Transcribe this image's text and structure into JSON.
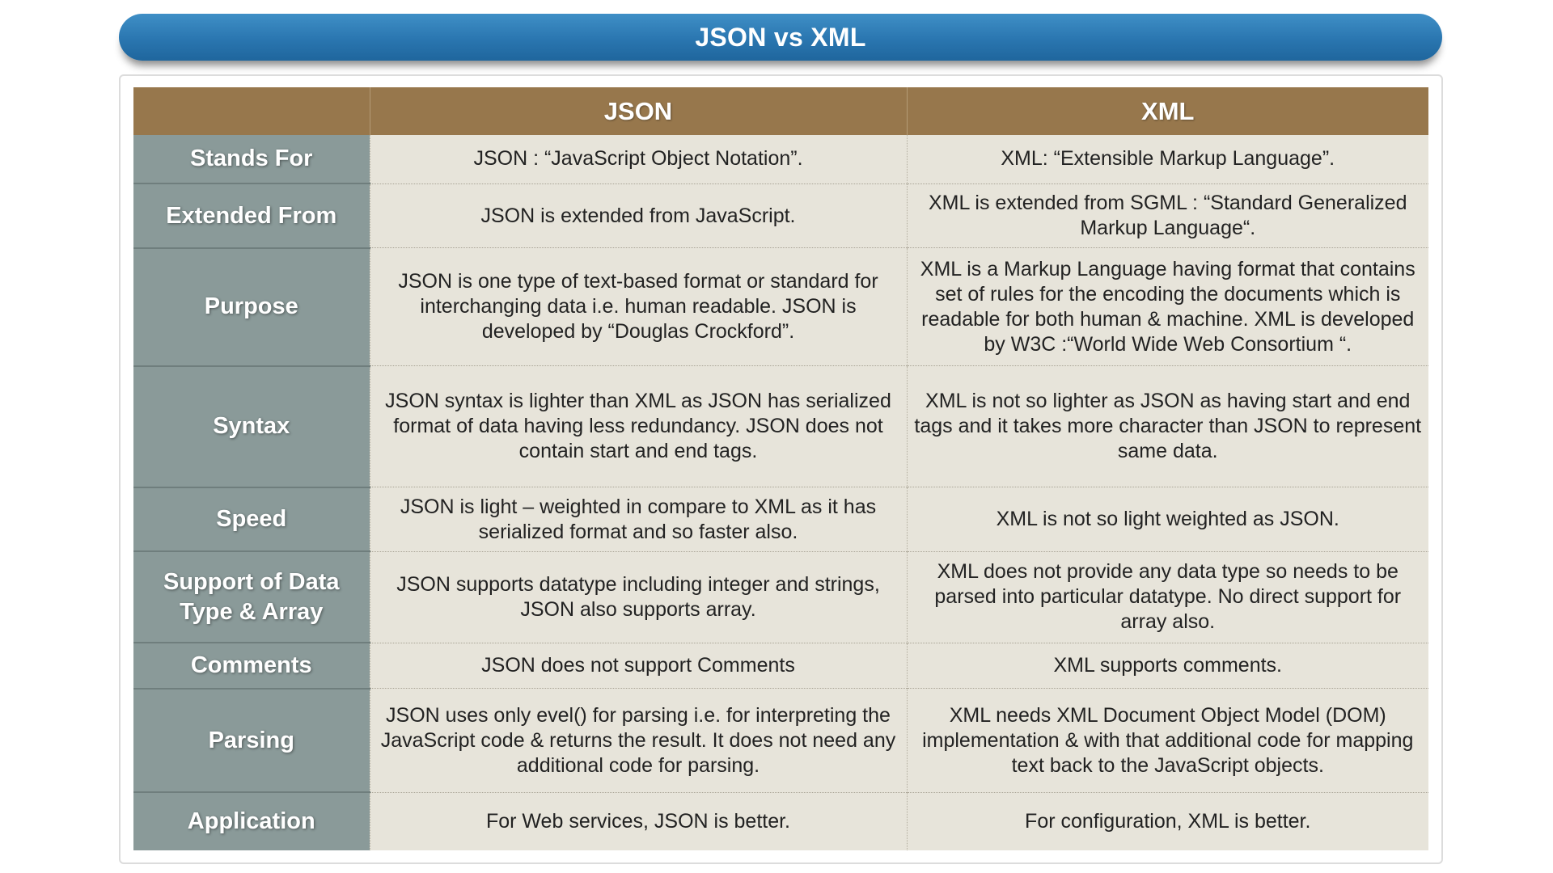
{
  "title": "JSON vs XML",
  "table": {
    "columns": [
      "",
      "JSON",
      "XML"
    ],
    "rows": [
      {
        "label": "Stands For",
        "json": "JSON : “JavaScript Object Notation”.",
        "xml": "XML: “Extensible Markup Language”."
      },
      {
        "label": "Extended From",
        "json": "JSON is extended from JavaScript.",
        "xml": "XML is extended from SGML : “Standard Generalized Markup Language“."
      },
      {
        "label": "Purpose",
        "json": "JSON is one type of text-based format or standard for interchanging  data i.e. human readable.  JSON is developed by “Douglas Crockford”.",
        "xml": "XML is a Markup Language having format that contains set of rules for the encoding the documents which is readable for both human & machine. XML is developed by W3C :“World Wide Web Consortium “."
      },
      {
        "label": "Syntax",
        "json": "JSON syntax is lighter than XML as JSON has serialized format of data having  less redundancy. JSON does not contain start and end tags.",
        "xml": "XML is not so lighter as JSON as having start and end tags and it takes more character than JSON to represent same data."
      },
      {
        "label": "Speed",
        "json": "JSON is light – weighted in compare to XML as it has serialized format and so faster also.",
        "xml": "XML is not so light weighted as JSON."
      },
      {
        "label": "Support of Data Type & Array",
        "json": "JSON supports datatype including integer and strings, JSON also supports array.",
        "xml": "XML does not provide any data type so needs to be parsed into particular datatype. No direct support for array also."
      },
      {
        "label": "Comments",
        "json": "JSON does not support Comments",
        "xml": "XML supports comments."
      },
      {
        "label": "Parsing",
        "json": "JSON uses only evel() for parsing i.e. for interpreting the JavaScript code & returns the result. It does not need any additional code for parsing.",
        "xml": "XML needs XML Document Object Model (DOM) implementation & with that additional code for mapping text back to the JavaScript objects."
      },
      {
        "label": "Application",
        "json": "For Web services, JSON is better.",
        "xml": "For configuration, XML is better."
      }
    ]
  },
  "colors": {
    "title_bar": "#2a76b0",
    "header_bg": "#97774c",
    "row_header_bg": "#8a9a99",
    "cell_bg": "#e7e4da"
  }
}
